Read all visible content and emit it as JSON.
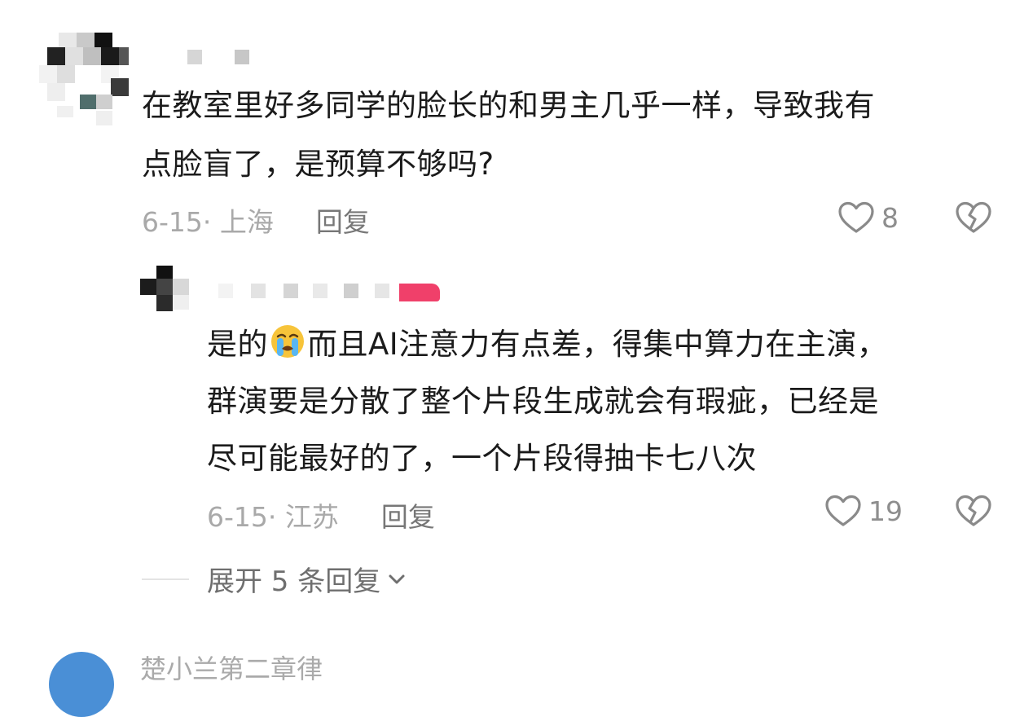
{
  "comment": {
    "avatar_icon": "avatar-mosaic",
    "text_lines": [
      "在教室里好多同学的脸长的和男主几乎一样，导致我有",
      "点脸盲了，是预算不够吗?"
    ],
    "date_location": "6-15· 上海",
    "reply_label": "回复",
    "like_count": "8",
    "like_icon": "heart-outline-icon",
    "dislike_icon": "broken-heart-icon"
  },
  "reply": {
    "avatar_icon": "avatar-mosaic",
    "text_before_emoji": "是的",
    "emoji": "loudly-crying-face-emoji",
    "text_line1_after_emoji": "而且AI注意力有点差，得集中算力在主演，",
    "text_line2": "群演要是分散了整个片段生成就会有瑕疵，已经是",
    "text_line3": "尽可能最好的了，一个片段得抽卡七八次",
    "date_location": "6-15· 江苏",
    "reply_label": "回复",
    "like_count": "19",
    "like_icon": "heart-outline-icon",
    "dislike_icon": "broken-heart-icon"
  },
  "expand": {
    "label": "展开 5 条回复",
    "icon": "chevron-down-icon"
  },
  "next_comment": {
    "name_partial": "楚小兰第二章律"
  },
  "colors": {
    "text_primary": "#1b1b1b",
    "text_secondary": "#8e8e8e",
    "accent_pink": "#f0406a"
  }
}
